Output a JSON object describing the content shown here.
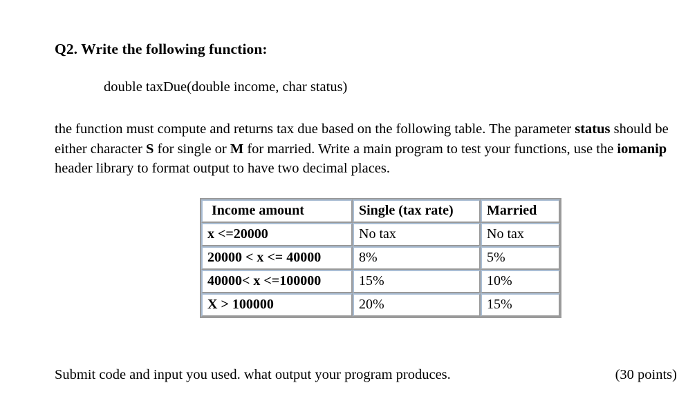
{
  "question": {
    "heading": "Q2. Write the following function:",
    "signature": "double taxDue(double income, char status)",
    "body": {
      "part1": "the function must compute and returns tax due based on the following table. The parameter ",
      "bold1": "status",
      "part2": " should be either character ",
      "bold2": "S",
      "part3": " for single or ",
      "bold3": "M",
      "part4": " for married. Write a main program to test your functions, use the ",
      "bold4": "iomanip",
      "part5": " header library to format output to have two decimal places."
    }
  },
  "table": {
    "headers": [
      "Income  amount",
      "Single (tax rate)",
      "Married"
    ],
    "rows": [
      {
        "income": "x <=20000",
        "single": "No tax",
        "married": "No tax"
      },
      {
        "income": "20000 < x <= 40000",
        "single": "8%",
        "married": "5%"
      },
      {
        "income": "40000< x <=100000",
        "single": "15%",
        "married": "10%"
      },
      {
        "income": "X > 100000",
        "single": "20%",
        "married": "15%"
      }
    ]
  },
  "footer": {
    "instruction": "Submit code and input you used. what output your program produces.",
    "points": "(30 points)"
  },
  "colors": {
    "text": "#000000",
    "page_background": "#ffffff",
    "cell_border_light": "#a9bdd4",
    "cell_border_dark": "#9a9a9a"
  }
}
